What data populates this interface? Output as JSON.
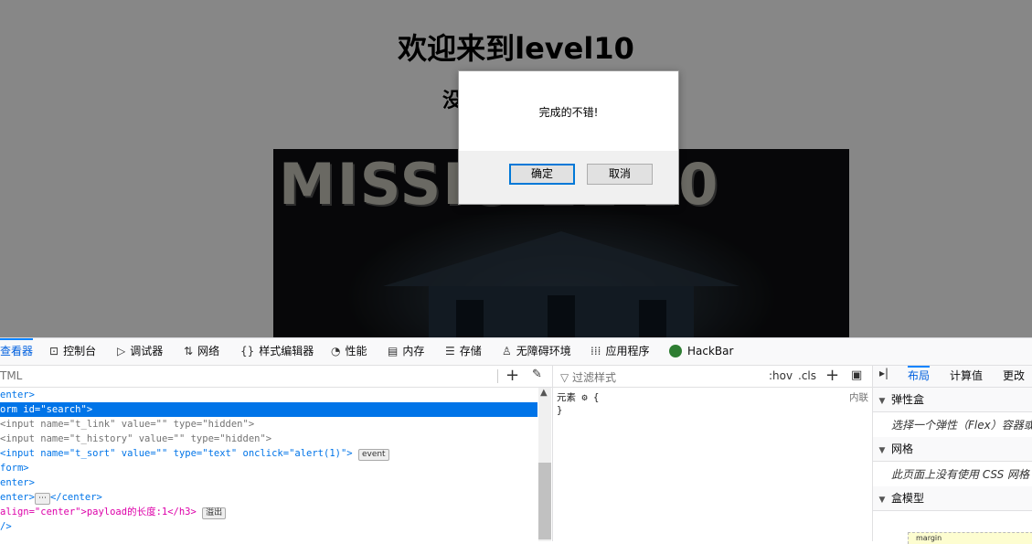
{
  "page": {
    "title": "欢迎来到level10",
    "subtitle_visible": "没",
    "banner_text": "MISSIO    EL 10"
  },
  "dialog": {
    "message": "完成的不错!",
    "ok": "确定",
    "cancel": "取消"
  },
  "devtools": {
    "tabs": [
      {
        "label": "查看器",
        "icon": "inspector-icon"
      },
      {
        "label": "控制台",
        "icon": "console-icon"
      },
      {
        "label": "调试器",
        "icon": "debugger-icon"
      },
      {
        "label": "网络",
        "icon": "network-icon"
      },
      {
        "label": "样式编辑器",
        "icon": "style-editor-icon"
      },
      {
        "label": "性能",
        "icon": "performance-icon"
      },
      {
        "label": "内存",
        "icon": "memory-icon"
      },
      {
        "label": "存储",
        "icon": "storage-icon"
      },
      {
        "label": "无障碍环境",
        "icon": "accessibility-icon"
      },
      {
        "label": "应用程序",
        "icon": "application-icon"
      },
      {
        "label": "HackBar",
        "icon": "hackbar-icon"
      }
    ],
    "inspector": {
      "search_placeholder": "TML",
      "lines": [
        {
          "tag_open": "enter>",
          "text": ""
        },
        {
          "tag_open": "orm id=\"search\">",
          "text": ""
        },
        {
          "text": "<input name=\"t_link\" value=\"\" type=\"hidden\">"
        },
        {
          "text": "<input name=\"t_history\" value=\"\" type=\"hidden\">"
        },
        {
          "text": "<input name=\"t_sort\" value=\"\" type=\"text\" onclick=\"alert(1)\">"
        },
        {
          "text": "form>"
        },
        {
          "text": "enter>"
        },
        {
          "text": "enter>",
          "suffix": "</center>"
        },
        {
          "text": "align=\"center\">payload的长度:1</h3>"
        },
        {
          "text": "/>"
        }
      ],
      "event_badge": "event",
      "overflow_badge": "溢出"
    },
    "rules": {
      "filter_placeholder": "过滤样式",
      "hov": ":hov",
      "cls": ".cls",
      "element_rule": "元素 ⚙ {",
      "close_brace": "}",
      "inline_label": "内联"
    },
    "layout": {
      "tabs": [
        "布局",
        "计算值",
        "更改"
      ],
      "flexbox_title": "弹性盒",
      "flexbox_hint": "选择一个弹性（Flex）容器或",
      "grid_title": "网格",
      "grid_hint": "此页面上没有使用 CSS 网格",
      "boxmodel_title": "盒模型",
      "boxmodel_margin": "margin"
    }
  }
}
